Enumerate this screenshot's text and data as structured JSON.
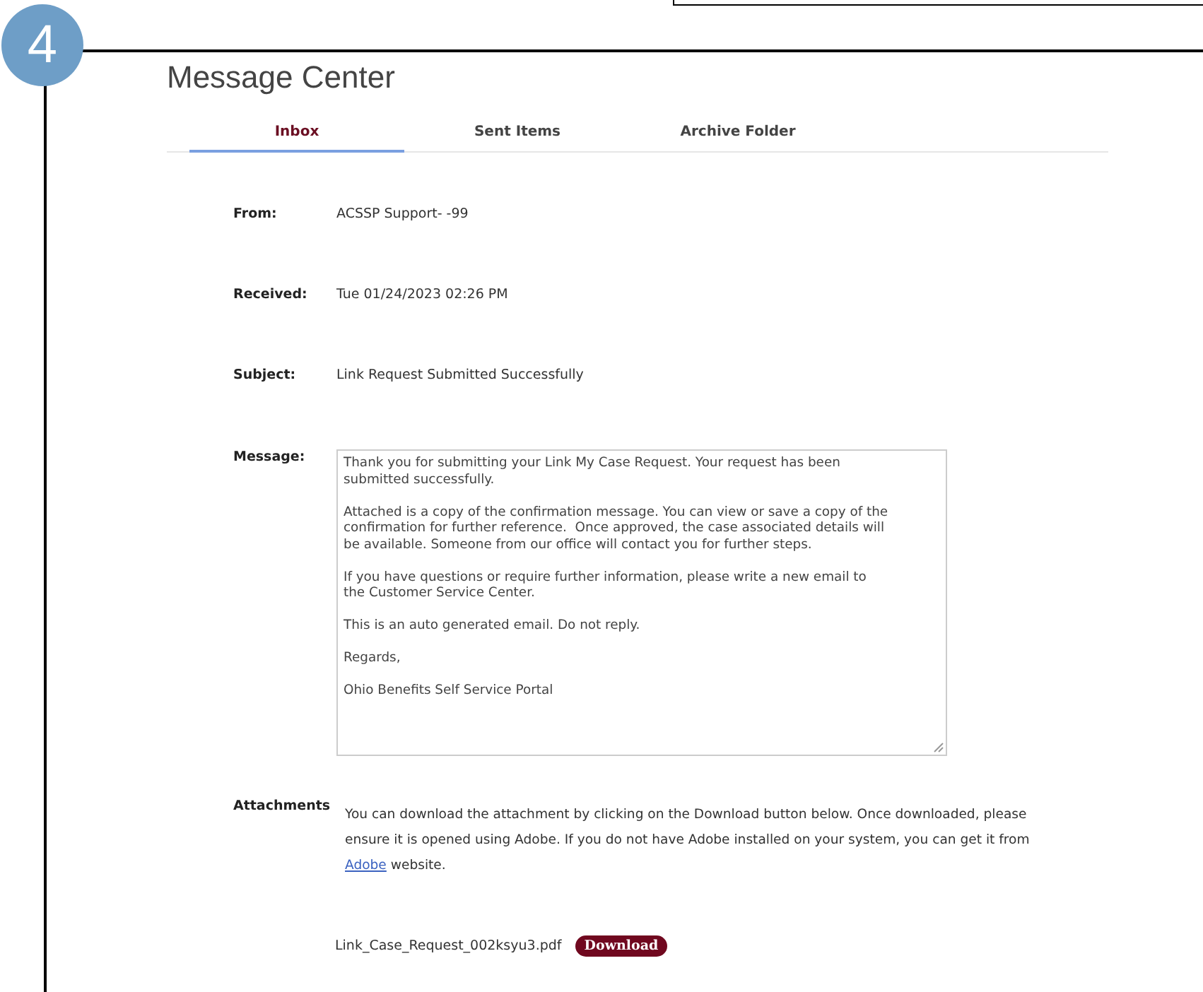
{
  "step_badge": "4",
  "title": "Message Center",
  "tabs": [
    {
      "label": "Inbox",
      "selected": true
    },
    {
      "label": "Sent Items",
      "selected": false
    },
    {
      "label": "Archive Folder",
      "selected": false
    }
  ],
  "fields": [
    {
      "label": "From:",
      "value": "ACSSP Support- -99"
    },
    {
      "label": "Received:",
      "value": "Tue 01/24/2023 02:26 PM"
    },
    {
      "label": "Subject:",
      "value": "Link Request Submitted Successfully"
    }
  ],
  "message": {
    "label": "Message:",
    "text": "Thank you for submitting your Link My Case Request. Your request has been\nsubmitted successfully.\n\nAttached is a copy of the confirmation message. You can view or save a copy of the\nconfirmation for further reference.  Once approved, the case associated details will\nbe available. Someone from our office will contact you for further steps.\n\nIf you have questions or require further information, please write a new email to\nthe Customer Service Center.\n\nThis is an auto generated email. Do not reply.\n\nRegards,\n\nOhio Benefits Self Service Portal"
  },
  "attachments": {
    "label": "Attachments",
    "note_before": "You can download the attachment by clicking on the Download button below. Once downloaded, please ensure it is opened using Adobe. If you do not have Adobe installed on your system, you can get it from ",
    "link": "Adobe",
    "note_after": " website.",
    "file": "Link_Case_Request_002ksyu3.pdf",
    "button": "Download"
  }
}
